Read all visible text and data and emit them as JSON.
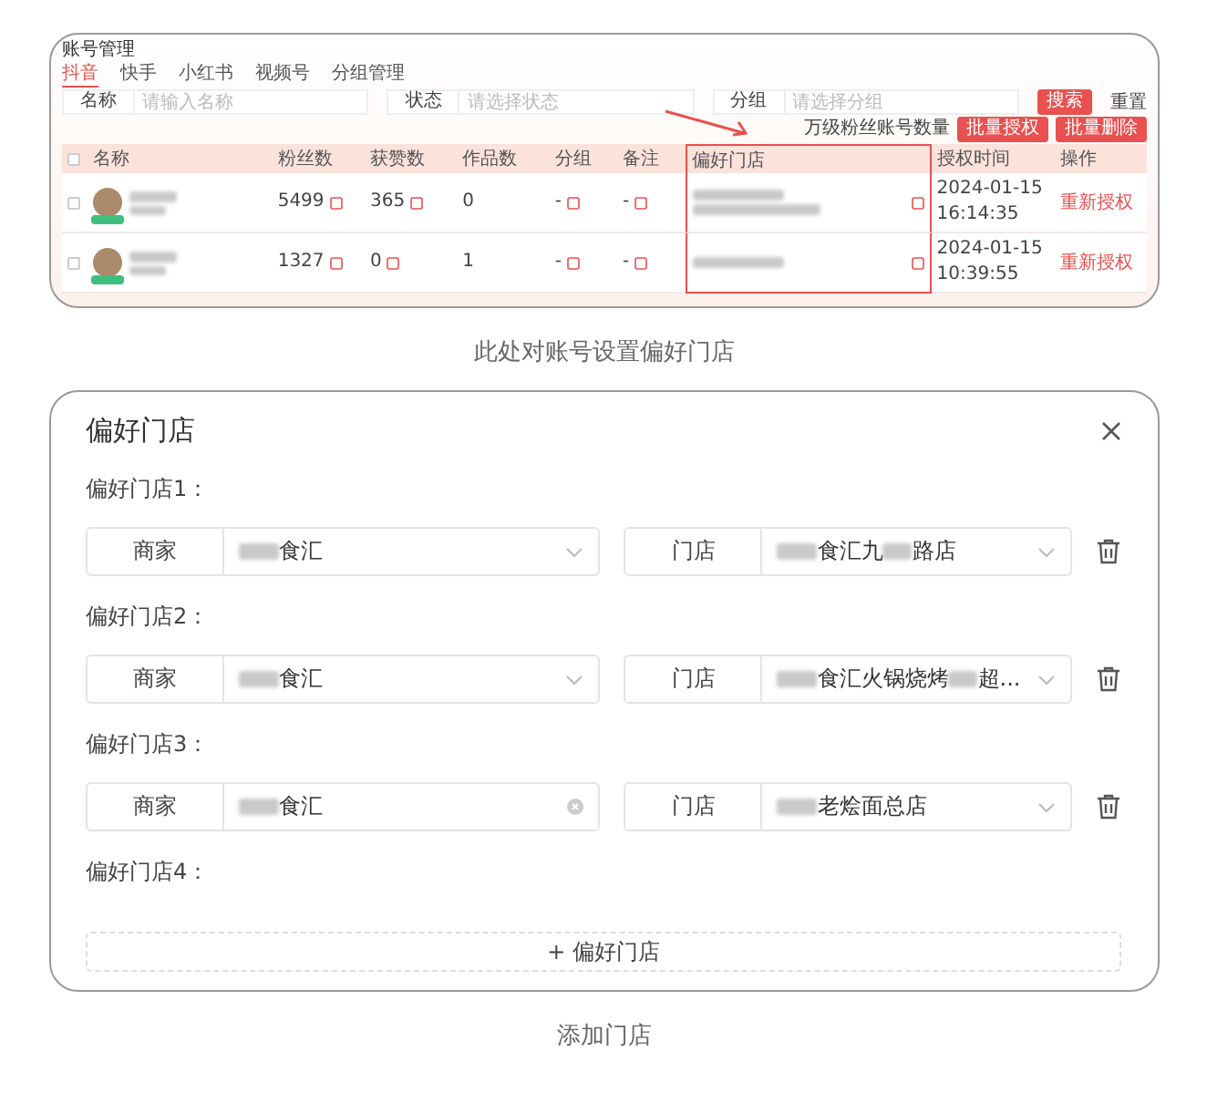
{
  "account_screen": {
    "title": "账号管理",
    "tabs": [
      {
        "label": "抖音",
        "selected": true
      },
      {
        "label": "快手",
        "selected": false
      },
      {
        "label": "小红书",
        "selected": false
      },
      {
        "label": "视频号",
        "selected": false
      },
      {
        "label": "分组管理",
        "selected": false
      }
    ],
    "filters": [
      {
        "label": "名称",
        "placeholder": "请输入名称"
      },
      {
        "label": "状态",
        "placeholder": "请选择状态"
      },
      {
        "label": "分组",
        "placeholder": "请选择分组"
      }
    ],
    "search_button": "搜索",
    "reset_button": "重置",
    "toolbar_note": "万级粉丝账号数量",
    "toolbar_buttons": [
      "批量授权",
      "批量删除"
    ],
    "header_checked": false,
    "columns": [
      {
        "label": "名称",
        "highlighted": false
      },
      {
        "label": "粉丝数",
        "highlighted": false
      },
      {
        "label": "获赞数",
        "highlighted": false
      },
      {
        "label": "作品数",
        "highlighted": false
      },
      {
        "label": "分组",
        "highlighted": false
      },
      {
        "label": "备注",
        "highlighted": false
      },
      {
        "label": "偏好门店",
        "highlighted": true
      },
      {
        "label": "授权时间",
        "highlighted": false
      },
      {
        "label": "操作",
        "highlighted": false
      }
    ],
    "rows": [
      {
        "fans": "5499",
        "likes": "365",
        "works": "0",
        "group": "-",
        "remark": "-",
        "checked": false,
        "date": "2024-01-15",
        "time": "16:14:35",
        "action": "重新授权"
      },
      {
        "fans": "1327",
        "likes": "0",
        "works": "1",
        "group": "-",
        "remark": "-",
        "checked": false,
        "date": "2024-01-15",
        "time": "10:39:55",
        "action": "重新授权"
      }
    ]
  },
  "caption_top": "此处对账号设置偏好门店",
  "dialog": {
    "title": "偏好门店",
    "groups": [
      {
        "kind": "pair",
        "label": "偏好门店1：",
        "merchant": {
          "label": "商家",
          "segments": [
            "食汇"
          ],
          "clearable": false
        },
        "store": {
          "label": "门店",
          "segments": [
            "食汇九",
            "路店"
          ],
          "clearable": false
        }
      },
      {
        "kind": "pair",
        "label": "偏好门店2：",
        "merchant": {
          "label": "商家",
          "segments": [
            "食汇"
          ],
          "clearable": false
        },
        "store": {
          "label": "门店",
          "segments": [
            "食汇火锅烧烤",
            "超..."
          ],
          "clearable": false
        }
      },
      {
        "kind": "pair",
        "label": "偏好门店3：",
        "merchant": {
          "label": "商家",
          "segments": [
            "食汇"
          ],
          "clearable": true
        },
        "store": {
          "label": "门店",
          "segments": [
            "老烩面总店"
          ],
          "clearable": false
        }
      },
      {
        "kind": "empty",
        "label": "偏好门店4："
      }
    ],
    "add_button": "+ 偏好门店"
  },
  "caption_bottom": "添加门店"
}
